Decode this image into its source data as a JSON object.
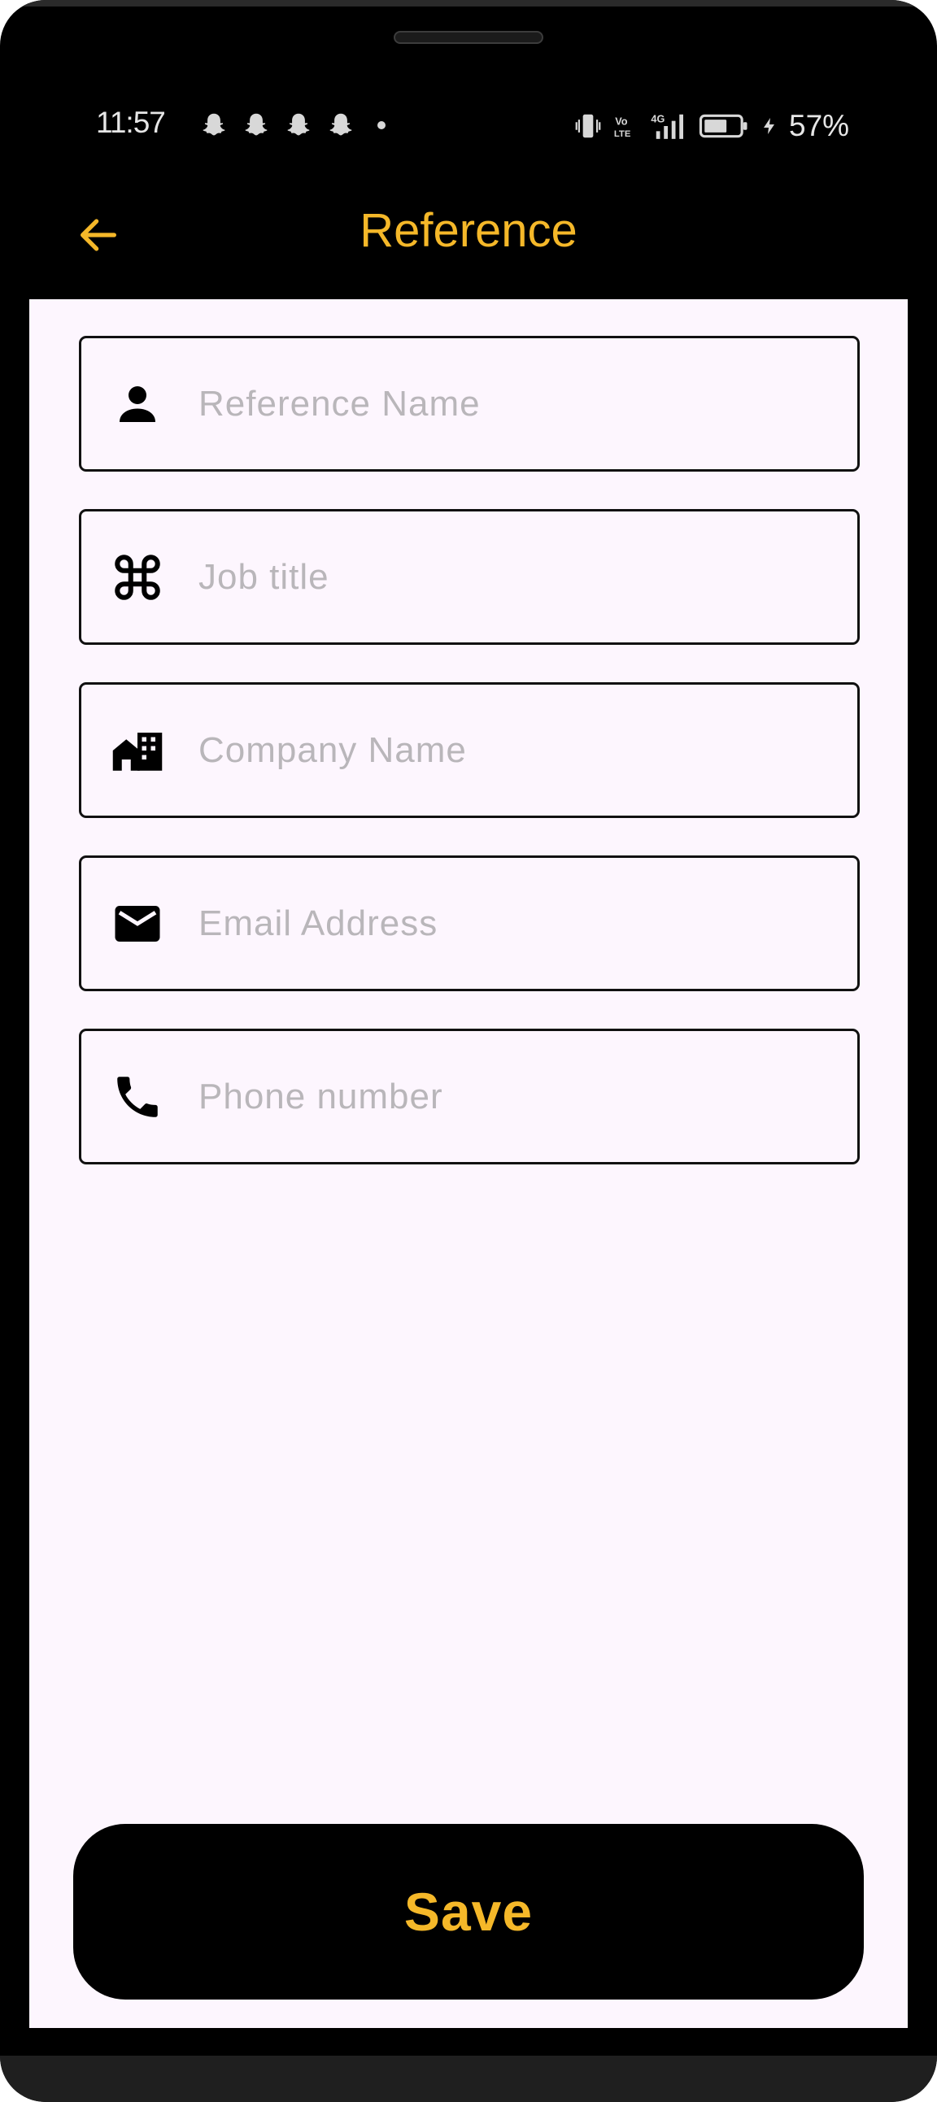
{
  "status_bar": {
    "time": "11:57",
    "battery_percent": "57%",
    "notification_icons": [
      "snapchat-icon",
      "snapchat-icon",
      "snapchat-icon",
      "snapchat-icon"
    ],
    "network_label": "4G"
  },
  "app_bar": {
    "title": "Reference",
    "back_icon": "arrow-back-icon"
  },
  "form": {
    "fields": [
      {
        "icon": "person-icon",
        "placeholder": "Reference Name",
        "value": ""
      },
      {
        "icon": "command-icon",
        "placeholder": "Job title",
        "value": ""
      },
      {
        "icon": "company-building-icon",
        "placeholder": "Company Name",
        "value": ""
      },
      {
        "icon": "mail-icon",
        "placeholder": "Email Address",
        "value": ""
      },
      {
        "icon": "phone-icon",
        "placeholder": "Phone number",
        "value": ""
      }
    ]
  },
  "actions": {
    "save_label": "Save"
  },
  "colors": {
    "accent": "#f5b829",
    "background": "#fdf6fe",
    "frame": "#000000",
    "placeholder": "#b9b6ba"
  }
}
